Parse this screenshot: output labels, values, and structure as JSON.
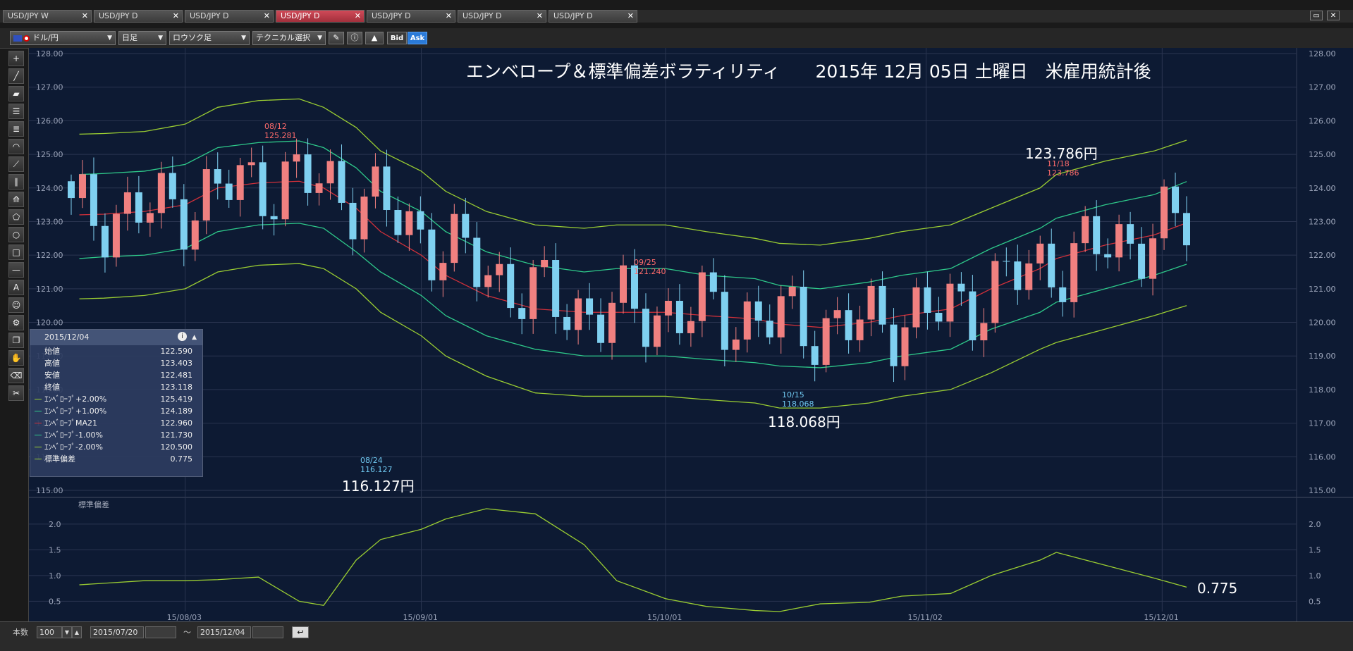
{
  "tabs": [
    {
      "label": "USD/JPY W",
      "active": false
    },
    {
      "label": "USD/JPY D",
      "active": false
    },
    {
      "label": "USD/JPY D",
      "active": false
    },
    {
      "label": "USD/JPY D",
      "active": true
    },
    {
      "label": "USD/JPY D",
      "active": false
    },
    {
      "label": "USD/JPY D",
      "active": false
    },
    {
      "label": "USD/JPY D",
      "active": false
    }
  ],
  "toolbar": {
    "pair": "ドル/円",
    "timeframe": "日足",
    "chart_type": "ロウソク足",
    "technical": "テクニカル選択",
    "bid": "Bid",
    "ask": "Ask"
  },
  "chart": {
    "title": "エンベロープ＆標準偏差ボラティリティ　　2015年 12月 05日 土曜日　米雇用統計後",
    "price_axis": [
      "128.00",
      "127.00",
      "126.00",
      "125.00",
      "124.00",
      "123.00",
      "122.00",
      "121.00",
      "120.00",
      "119.00",
      "118.00",
      "117.00",
      "116.00",
      "115.00"
    ],
    "x_labels": [
      "15/08/03",
      "15/09/01",
      "15/10/01",
      "15/11/02",
      "15/12/01"
    ],
    "annotations": [
      {
        "date": "08/12",
        "price": "125.281",
        "color": "#ff6b6b"
      },
      {
        "date": "09/25",
        "price": "121.240",
        "color": "#ff6b6b"
      },
      {
        "date": "11/18",
        "price": "123.786",
        "color": "#ff6b6b"
      },
      {
        "date": "08/24",
        "price": "116.127",
        "color": "#6fc8f0"
      },
      {
        "date": "10/15",
        "price": "118.068",
        "color": "#6fc8f0"
      }
    ],
    "big_labels": [
      "123.786円",
      "118.068円",
      "116.127円"
    ],
    "sub_title": "標準偏差",
    "sub_axis": [
      "2.0",
      "1.5",
      "1.0",
      "0.5"
    ],
    "sub_value": "0.775"
  },
  "info_panel": {
    "date": "2015/12/04",
    "rows": [
      {
        "label": "始値",
        "value": "122.590",
        "color": ""
      },
      {
        "label": "高値",
        "value": "123.403",
        "color": ""
      },
      {
        "label": "安値",
        "value": "122.481",
        "color": ""
      },
      {
        "label": "終値",
        "value": "123.118",
        "color": ""
      },
      {
        "label": "ｴﾝﾍﾞﾛｰﾌﾟ+2.00%",
        "value": "125.419",
        "color": "#9acd32"
      },
      {
        "label": "ｴﾝﾍﾞﾛｰﾌﾟ+1.00%",
        "value": "124.189",
        "color": "#2ec98a"
      },
      {
        "label": "ｴﾝﾍﾞﾛｰﾌﾟMA21",
        "value": "122.960",
        "color": "#d0303a"
      },
      {
        "label": "ｴﾝﾍﾞﾛｰﾌﾟ-1.00%",
        "value": "121.730",
        "color": "#2ec98a"
      },
      {
        "label": "ｴﾝﾍﾞﾛｰﾌﾟ-2.00%",
        "value": "120.500",
        "color": "#9acd32"
      },
      {
        "label": "標準偏差",
        "value": "0.775",
        "color": "#9acd32"
      }
    ]
  },
  "bottom": {
    "count_label": "本数",
    "count_value": "100",
    "date_from": "2015/07/20",
    "tilde": "～",
    "date_to": "2015/12/04"
  },
  "chart_data": {
    "type": "line",
    "ylim": [
      115,
      128
    ],
    "x": [
      "2015-07-21",
      "2015-07-24",
      "2015-07-29",
      "2015-08-03",
      "2015-08-07",
      "2015-08-12",
      "2015-08-17",
      "2015-08-20",
      "2015-08-24",
      "2015-08-27",
      "2015-09-01",
      "2015-09-04",
      "2015-09-09",
      "2015-09-15",
      "2015-09-21",
      "2015-09-25",
      "2015-10-01",
      "2015-10-06",
      "2015-10-12",
      "2015-10-15",
      "2015-10-20",
      "2015-10-26",
      "2015-10-30",
      "2015-11-05",
      "2015-11-10",
      "2015-11-16",
      "2015-11-18",
      "2015-11-24",
      "2015-11-30",
      "2015-12-04"
    ],
    "series": [
      {
        "name": "ｴﾝﾍﾞﾛｰﾌﾟ+2.00%",
        "color": "#9acd32",
        "values": [
          125.6,
          125.62,
          125.68,
          125.9,
          126.4,
          126.6,
          126.65,
          126.4,
          125.8,
          125.1,
          124.5,
          123.9,
          123.3,
          122.9,
          122.8,
          122.9,
          122.9,
          122.7,
          122.5,
          122.35,
          122.3,
          122.5,
          122.7,
          122.9,
          123.4,
          124.0,
          124.4,
          124.8,
          125.1,
          125.42
        ]
      },
      {
        "name": "ｴﾝﾍﾞﾛｰﾌﾟ+1.00%",
        "color": "#2ec98a",
        "values": [
          124.4,
          124.43,
          124.5,
          124.7,
          125.2,
          125.35,
          125.4,
          125.2,
          124.6,
          123.9,
          123.3,
          122.7,
          122.1,
          121.7,
          121.5,
          121.6,
          121.6,
          121.4,
          121.3,
          121.1,
          121.0,
          121.2,
          121.4,
          121.6,
          122.2,
          122.8,
          123.1,
          123.5,
          123.8,
          124.19
        ]
      },
      {
        "name": "ｴﾝﾍﾞﾛｰﾌﾟMA21",
        "color": "#d0303a",
        "values": [
          123.2,
          123.22,
          123.3,
          123.5,
          124.0,
          124.15,
          124.2,
          124.0,
          123.4,
          122.7,
          122.0,
          121.4,
          120.8,
          120.4,
          120.3,
          120.3,
          120.3,
          120.2,
          120.1,
          119.95,
          119.85,
          120.0,
          120.2,
          120.4,
          121.0,
          121.6,
          121.9,
          122.3,
          122.6,
          122.96
        ]
      },
      {
        "name": "ｴﾝﾍﾞﾛｰﾌﾟ-1.00%",
        "color": "#2ec98a",
        "values": [
          121.9,
          121.95,
          122.0,
          122.2,
          122.7,
          122.9,
          122.95,
          122.8,
          122.1,
          121.5,
          120.8,
          120.2,
          119.6,
          119.2,
          119.0,
          119.0,
          119.0,
          118.9,
          118.8,
          118.7,
          118.65,
          118.8,
          119.0,
          119.2,
          119.8,
          120.3,
          120.6,
          121.0,
          121.4,
          121.73
        ]
      },
      {
        "name": "ｴﾝﾍﾞﾛｰﾌﾟ-2.00%",
        "color": "#9acd32",
        "values": [
          120.7,
          120.72,
          120.8,
          121.0,
          121.5,
          121.7,
          121.75,
          121.6,
          121.0,
          120.3,
          119.6,
          119.0,
          118.4,
          117.9,
          117.8,
          117.8,
          117.8,
          117.7,
          117.6,
          117.45,
          117.45,
          117.6,
          117.8,
          118.0,
          118.5,
          119.2,
          119.4,
          119.8,
          120.2,
          120.5
        ]
      },
      {
        "name": "標準偏差",
        "color": "#9acd32",
        "values": [
          0.82,
          0.85,
          0.9,
          0.9,
          0.92,
          0.97,
          0.5,
          0.42,
          1.3,
          1.7,
          1.9,
          2.1,
          2.3,
          2.2,
          1.6,
          0.9,
          0.55,
          0.4,
          0.32,
          0.3,
          0.45,
          0.48,
          0.6,
          0.65,
          1.0,
          1.3,
          1.45,
          1.2,
          0.95,
          0.775
        ]
      }
    ]
  }
}
